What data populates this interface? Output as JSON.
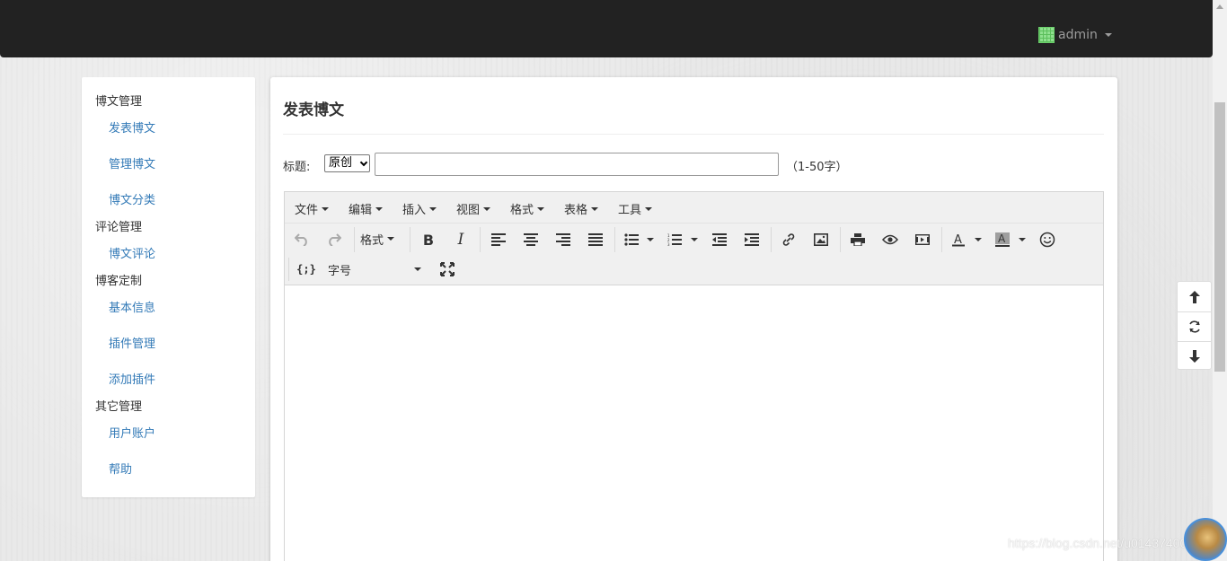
{
  "navbar": {
    "user": "admin"
  },
  "sidebar": {
    "groups": [
      {
        "label": "博文管理",
        "items": [
          "发表博文",
          "管理博文",
          "博文分类"
        ]
      },
      {
        "label": "评论管理",
        "items": [
          "博文评论"
        ]
      },
      {
        "label": "博客定制",
        "items": [
          "基本信息",
          "插件管理",
          "添加插件"
        ]
      },
      {
        "label": "其它管理",
        "items": [
          "用户账户",
          "帮助"
        ]
      }
    ]
  },
  "main": {
    "heading": "发表博文",
    "title_label": "标题:",
    "title_type": "原创",
    "title_value": "",
    "title_hint": "（1-50字）"
  },
  "editor": {
    "menus": [
      "文件",
      "编辑",
      "插入",
      "视图",
      "格式",
      "表格",
      "工具"
    ],
    "format_label": "格式",
    "fontsize_label": "字号",
    "icons": [
      "undo-icon",
      "redo-icon",
      "bold-icon",
      "italic-icon",
      "align-left-icon",
      "align-center-icon",
      "align-right-icon",
      "align-justify-icon",
      "bullet-list-icon",
      "numbered-list-icon",
      "outdent-icon",
      "indent-icon",
      "link-icon",
      "image-icon",
      "print-icon",
      "preview-icon",
      "media-icon",
      "text-color-icon",
      "background-color-icon",
      "emoticon-icon",
      "code-sample-icon",
      "fullscreen-icon"
    ]
  },
  "watermark": "https://blog.csdn.net/u014374009",
  "colors": {
    "navbar": "#222222",
    "link": "#337ab7",
    "toolbar": "#f0f0f0"
  }
}
